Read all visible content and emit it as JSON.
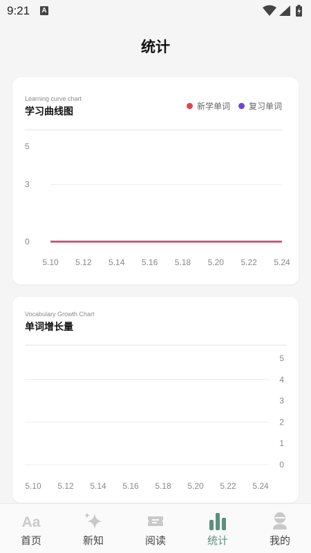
{
  "status_bar": {
    "time": "9:21",
    "notification_letter": "A"
  },
  "page_title": "统计",
  "charts": {
    "learning": {
      "subtitle": "Learning curve chart",
      "title": "学习曲线图",
      "legend": [
        {
          "label": "新学单词",
          "color": "#e5434c"
        },
        {
          "label": "复习单词",
          "color": "#6a45d8"
        }
      ]
    },
    "growth": {
      "subtitle": "Vocabulary Growth Chart",
      "title": "单词增长量"
    }
  },
  "chart_data": [
    {
      "type": "line",
      "title": "学习曲线图",
      "subtitle": "Learning curve chart",
      "x_ticks": [
        "5.10",
        "5.12",
        "5.14",
        "5.16",
        "5.18",
        "5.20",
        "5.22",
        "5.24"
      ],
      "y_ticks": [
        0,
        3,
        5
      ],
      "ylim": [
        0,
        5
      ],
      "series": [
        {
          "name": "新学单词",
          "color": "#e5434c",
          "values": [
            0,
            0,
            0,
            0,
            0,
            0,
            0,
            0
          ]
        },
        {
          "name": "复习单词",
          "color": "#6a45d8",
          "values": [
            0,
            0,
            0,
            0,
            0,
            0,
            0,
            0
          ]
        }
      ],
      "grid": true,
      "legend_position": "top-right"
    },
    {
      "type": "line",
      "title": "单词增长量",
      "subtitle": "Vocabulary Growth Chart",
      "x_ticks": [
        "5.10",
        "5.12",
        "5.14",
        "5.16",
        "5.18",
        "5.20",
        "5.22",
        "5.24"
      ],
      "y_ticks": [
        0,
        1,
        2,
        3,
        4,
        5
      ],
      "ylim": [
        0,
        5
      ],
      "y_axis_position": "right",
      "series": [],
      "grid": true
    }
  ],
  "nav": {
    "items": [
      {
        "label": "首页",
        "icon": "font-aa-icon",
        "active": false
      },
      {
        "label": "新知",
        "icon": "sparkle-icon",
        "active": false
      },
      {
        "label": "阅读",
        "icon": "ticket-icon",
        "active": false
      },
      {
        "label": "统计",
        "icon": "bar-chart-icon",
        "active": true
      },
      {
        "label": "我的",
        "icon": "user-icon",
        "active": false
      }
    ],
    "active_color": "#5b8f7e",
    "inactive_icon_color": "#c9c9c9"
  }
}
